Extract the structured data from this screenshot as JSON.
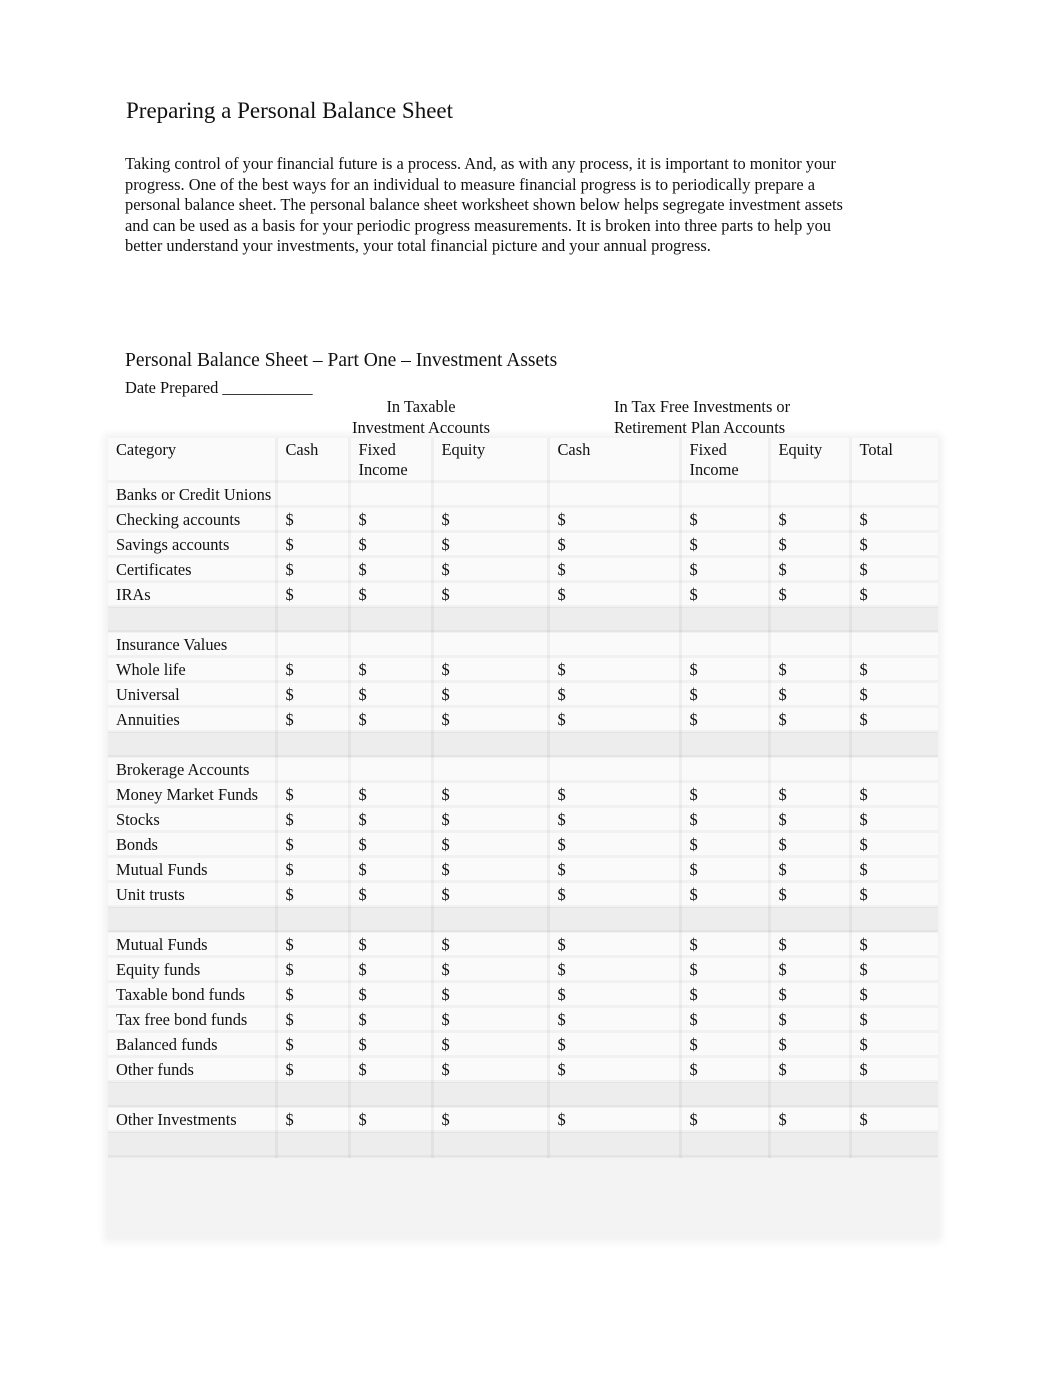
{
  "document": {
    "title": "Preparing a Personal Balance Sheet",
    "intro": "Taking control of your financial future is a process. And, as with any process, it is important to monitor your progress. One of the best ways for an individual to measure financial progress is to periodically prepare a personal balance sheet. The personal balance sheet worksheet shown below helps segregate investment assets and can be used as a basis for your periodic progress measurements. It is broken into three parts to help you better understand your investments, your total financial picture and your annual progress.",
    "part_title": "Personal Balance Sheet – Part One – Investment Assets",
    "date_prepared": "Date Prepared ___________",
    "group_headers": {
      "taxable_line1": "In Taxable",
      "taxable_line2": "Investment Accounts",
      "taxfree_line1": "In Tax Free Investments or",
      "taxfree_line2": "Retirement Plan Accounts"
    }
  },
  "table": {
    "columns": [
      "Category",
      "Cash",
      "Fixed Income",
      "Equity",
      "Cash",
      "Fixed Income",
      "Equity",
      "Total"
    ],
    "currency_symbol": "$",
    "rows": [
      {
        "label": "Banks or Credit Unions",
        "type": "section"
      },
      {
        "label": "Checking accounts",
        "type": "item"
      },
      {
        "label": "Savings accounts",
        "type": "item"
      },
      {
        "label": "Certificates",
        "type": "item"
      },
      {
        "label": "IRAs",
        "type": "item"
      },
      {
        "label": "",
        "type": "blank"
      },
      {
        "label": "Insurance Values",
        "type": "section"
      },
      {
        "label": "Whole life",
        "type": "item"
      },
      {
        "label": "Universal",
        "type": "item"
      },
      {
        "label": "Annuities",
        "type": "item"
      },
      {
        "label": "",
        "type": "blank"
      },
      {
        "label": "Brokerage Accounts",
        "type": "section"
      },
      {
        "label": "Money Market Funds",
        "type": "item"
      },
      {
        "label": "Stocks",
        "type": "item"
      },
      {
        "label": "Bonds",
        "type": "item"
      },
      {
        "label": "Mutual Funds",
        "type": "item"
      },
      {
        "label": "Unit trusts",
        "type": "item"
      },
      {
        "label": "",
        "type": "blank"
      },
      {
        "label": "Mutual Funds",
        "type": "item"
      },
      {
        "label": "Equity funds",
        "type": "item"
      },
      {
        "label": "Taxable bond funds",
        "type": "item"
      },
      {
        "label": "Tax free bond funds",
        "type": "item"
      },
      {
        "label": "Balanced funds",
        "type": "item"
      },
      {
        "label": "Other funds",
        "type": "item"
      },
      {
        "label": "",
        "type": "blank"
      },
      {
        "label": "Other Investments",
        "type": "item"
      },
      {
        "label": "",
        "type": "blank"
      }
    ]
  }
}
